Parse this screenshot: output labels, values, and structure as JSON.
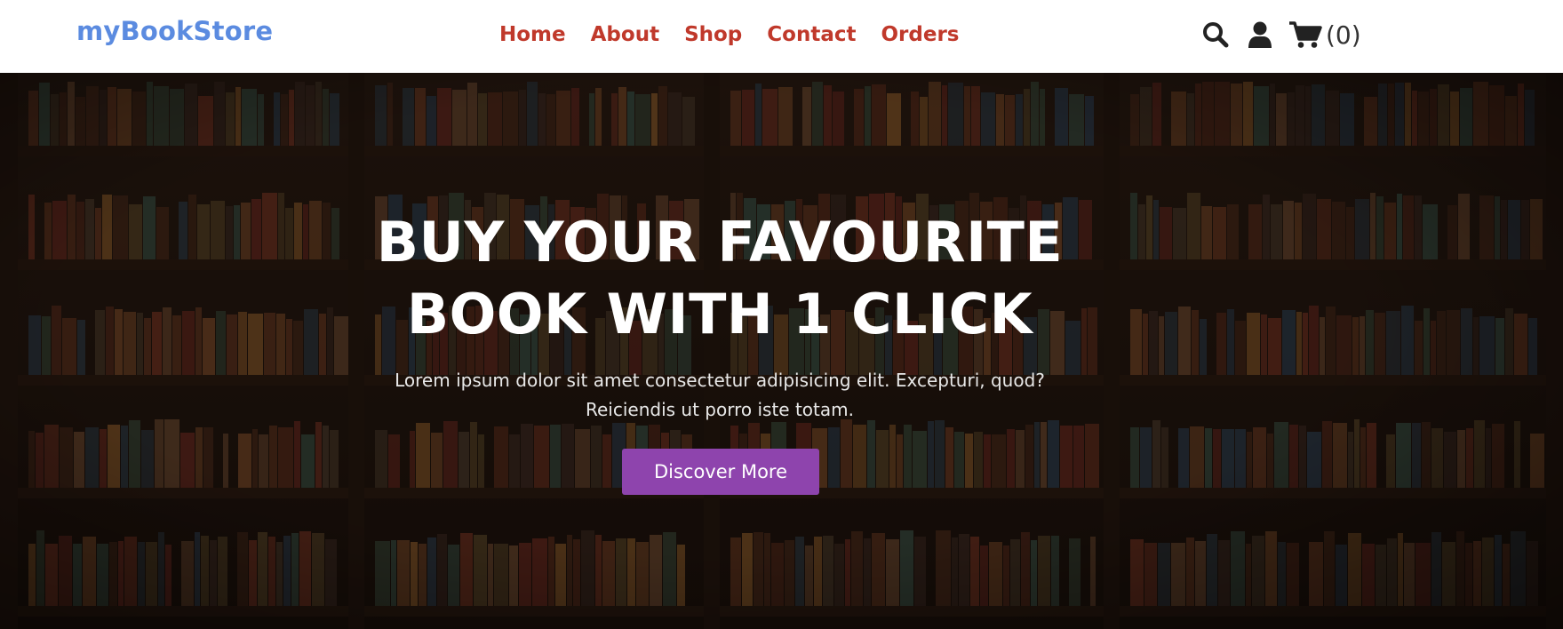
{
  "header": {
    "logo": "myBookStore",
    "nav": [
      "Home",
      "About",
      "Shop",
      "Contact",
      "Orders"
    ],
    "icons": {
      "search": "search-icon",
      "user": "user-icon",
      "cart": "cart-icon"
    },
    "cart_count": "(0)"
  },
  "hero": {
    "title": "BUY YOUR FAVOURITE BOOK WITH 1 CLICK",
    "text": "Lorem ipsum dolor sit amet consectetur adipisicing elit. Excepturi, quod? Reiciendis ut porro iste totam.",
    "button": "Discover More"
  },
  "colors": {
    "logo": "#5b8be0",
    "nav": "#c0392b",
    "button": "#8e44ad"
  }
}
